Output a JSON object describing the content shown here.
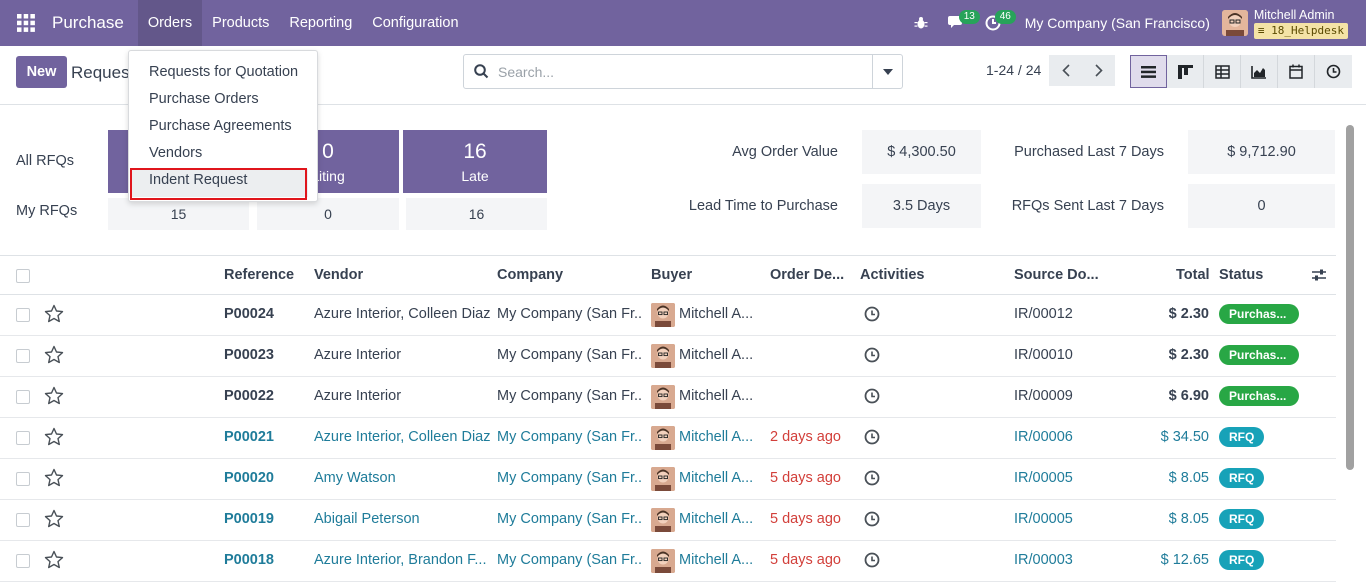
{
  "navbar": {
    "app_title": "Purchase",
    "menus": [
      "Orders",
      "Products",
      "Reporting",
      "Configuration"
    ],
    "messages_badge": "13",
    "activities_badge": "46",
    "company": "My Company (San Francisco)",
    "user_name": "Mitchell Admin",
    "database": "18_Helpdesk"
  },
  "orders_menu": {
    "items": [
      "Requests for Quotation",
      "Purchase Orders",
      "Purchase Agreements",
      "Vendors",
      "Indent Request"
    ]
  },
  "control": {
    "new_label": "New",
    "breadcrumb": "Reques",
    "search_placeholder": "Search...",
    "pager": "1-24 / 24"
  },
  "dashboard": {
    "all_rfqs_label": "All RFQs",
    "my_rfqs_label": "My RFQs",
    "tiles": [
      {
        "num": "0",
        "label": "aiting"
      },
      {
        "num": "16",
        "label": "Late"
      }
    ],
    "my_values": [
      "15",
      "0",
      "16"
    ],
    "kpis": [
      {
        "label": "Avg Order Value",
        "value": "$ 4,300.50"
      },
      {
        "label": "Purchased Last 7 Days",
        "value": "$ 9,712.90"
      },
      {
        "label": "Lead Time to Purchase",
        "value": "3.5 Days"
      },
      {
        "label": "RFQs Sent Last 7 Days",
        "value": "0"
      }
    ]
  },
  "table": {
    "headers": [
      "Reference",
      "Vendor",
      "Company",
      "Buyer",
      "Order De...",
      "Activities",
      "Source Do...",
      "Total",
      "Status"
    ],
    "rows": [
      {
        "ref": "P00024",
        "vendor": "Azure Interior, Colleen Diaz",
        "company": "My Company (San Fr...",
        "buyer": "Mitchell A...",
        "deadline": "",
        "source": "IR/00012",
        "total": "$ 2.30",
        "status": "Purchas...",
        "kind": "po"
      },
      {
        "ref": "P00023",
        "vendor": "Azure Interior",
        "company": "My Company (San Fr...",
        "buyer": "Mitchell A...",
        "deadline": "",
        "source": "IR/00010",
        "total": "$ 2.30",
        "status": "Purchas...",
        "kind": "po"
      },
      {
        "ref": "P00022",
        "vendor": "Azure Interior",
        "company": "My Company (San Fr...",
        "buyer": "Mitchell A...",
        "deadline": "",
        "source": "IR/00009",
        "total": "$ 6.90",
        "status": "Purchas...",
        "kind": "po"
      },
      {
        "ref": "P00021",
        "vendor": "Azure Interior, Colleen Diaz",
        "company": "My Company (San Fr...",
        "buyer": "Mitchell A...",
        "deadline": "2 days ago",
        "source": "IR/00006",
        "total": "$ 34.50",
        "status": "RFQ",
        "kind": "rfq"
      },
      {
        "ref": "P00020",
        "vendor": "Amy Watson",
        "company": "My Company (San Fr...",
        "buyer": "Mitchell A...",
        "deadline": "5 days ago",
        "source": "IR/00005",
        "total": "$ 8.05",
        "status": "RFQ",
        "kind": "rfq"
      },
      {
        "ref": "P00019",
        "vendor": "Abigail Peterson",
        "company": "My Company (San Fr...",
        "buyer": "Mitchell A...",
        "deadline": "5 days ago",
        "source": "IR/00005",
        "total": "$ 8.05",
        "status": "RFQ",
        "kind": "rfq"
      },
      {
        "ref": "P00018",
        "vendor": "Azure Interior, Brandon F...",
        "company": "My Company (San Fr...",
        "buyer": "Mitchell A...",
        "deadline": "5 days ago",
        "source": "IR/00003",
        "total": "$ 12.65",
        "status": "RFQ",
        "kind": "rfq"
      }
    ]
  }
}
